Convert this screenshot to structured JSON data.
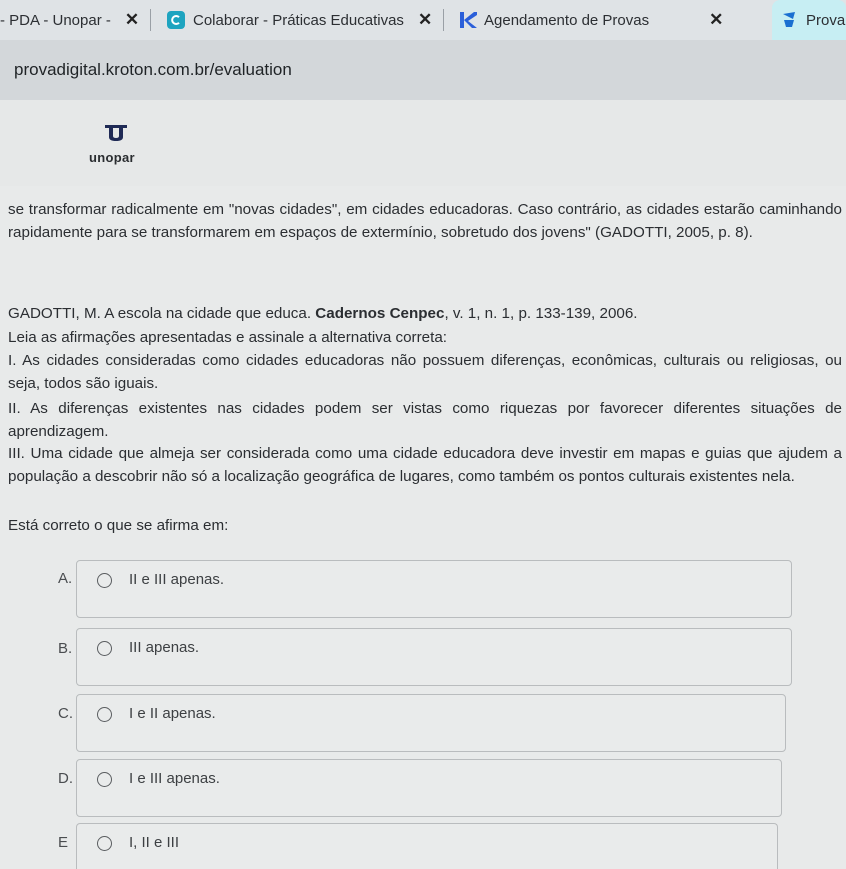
{
  "tabs": [
    {
      "label": "- PDA - Unopar -",
      "active": false,
      "favicon_icon": "none",
      "close_icon": "close-icon"
    },
    {
      "label": "Colaborar - Práticas Educativas",
      "active": false,
      "favicon_icon": "colaborar-icon",
      "favicon_color": "#1ea4c0"
    },
    {
      "label": "Agendamento de Provas",
      "active": false,
      "favicon_icon": "kroton-icon",
      "favicon_color": "#2b5fd9"
    },
    {
      "label": "Prova",
      "active": true,
      "favicon_icon": "prova-icon",
      "favicon_color": "#1a6fd1"
    }
  ],
  "address": {
    "url": "provadigital.kroton.com.br/evaluation"
  },
  "brand": {
    "name": "unopar"
  },
  "question": {
    "quote": "se transformar radicalmente em \"novas cidades\", em cidades educadoras. Caso contrário, as cidades estarão caminhando rapidamente para se transformarem em espaços de extermínio, sobretudo dos jovens\" (GADOTTI, 2005, p. 8).",
    "reference_prefix": "GADOTTI, M. A escola na cidade que educa. ",
    "reference_bold": "Cadernos Cenpec",
    "reference_suffix": ", v. 1, n. 1, p. 133-139, 2006.",
    "lead": "Leia as afirmações apresentadas e assinale a alternativa correta:",
    "statements": [
      "I. As cidades consideradas como cidades educadoras não possuem diferenças, econômicas, culturais ou religiosas, ou seja, todos são iguais.",
      "II. As diferenças existentes nas cidades podem ser vistas como riquezas por favorecer diferentes situações de aprendizagem.",
      "III. Uma cidade que almeja ser considerada como uma cidade educadora deve investir em mapas e guias que ajudem a população a descobrir não só a localização geográfica de lugares, como também os pontos culturais existentes nela."
    ],
    "prompt": "Está correto o que se afirma em:"
  },
  "options": [
    {
      "letter": "A.",
      "text": "II e III apenas."
    },
    {
      "letter": "B.",
      "text": "III apenas."
    },
    {
      "letter": "C.",
      "text": "I e II apenas."
    },
    {
      "letter": "D.",
      "text": "I e III apenas."
    },
    {
      "letter": "E",
      "text": "I, II e III"
    }
  ]
}
